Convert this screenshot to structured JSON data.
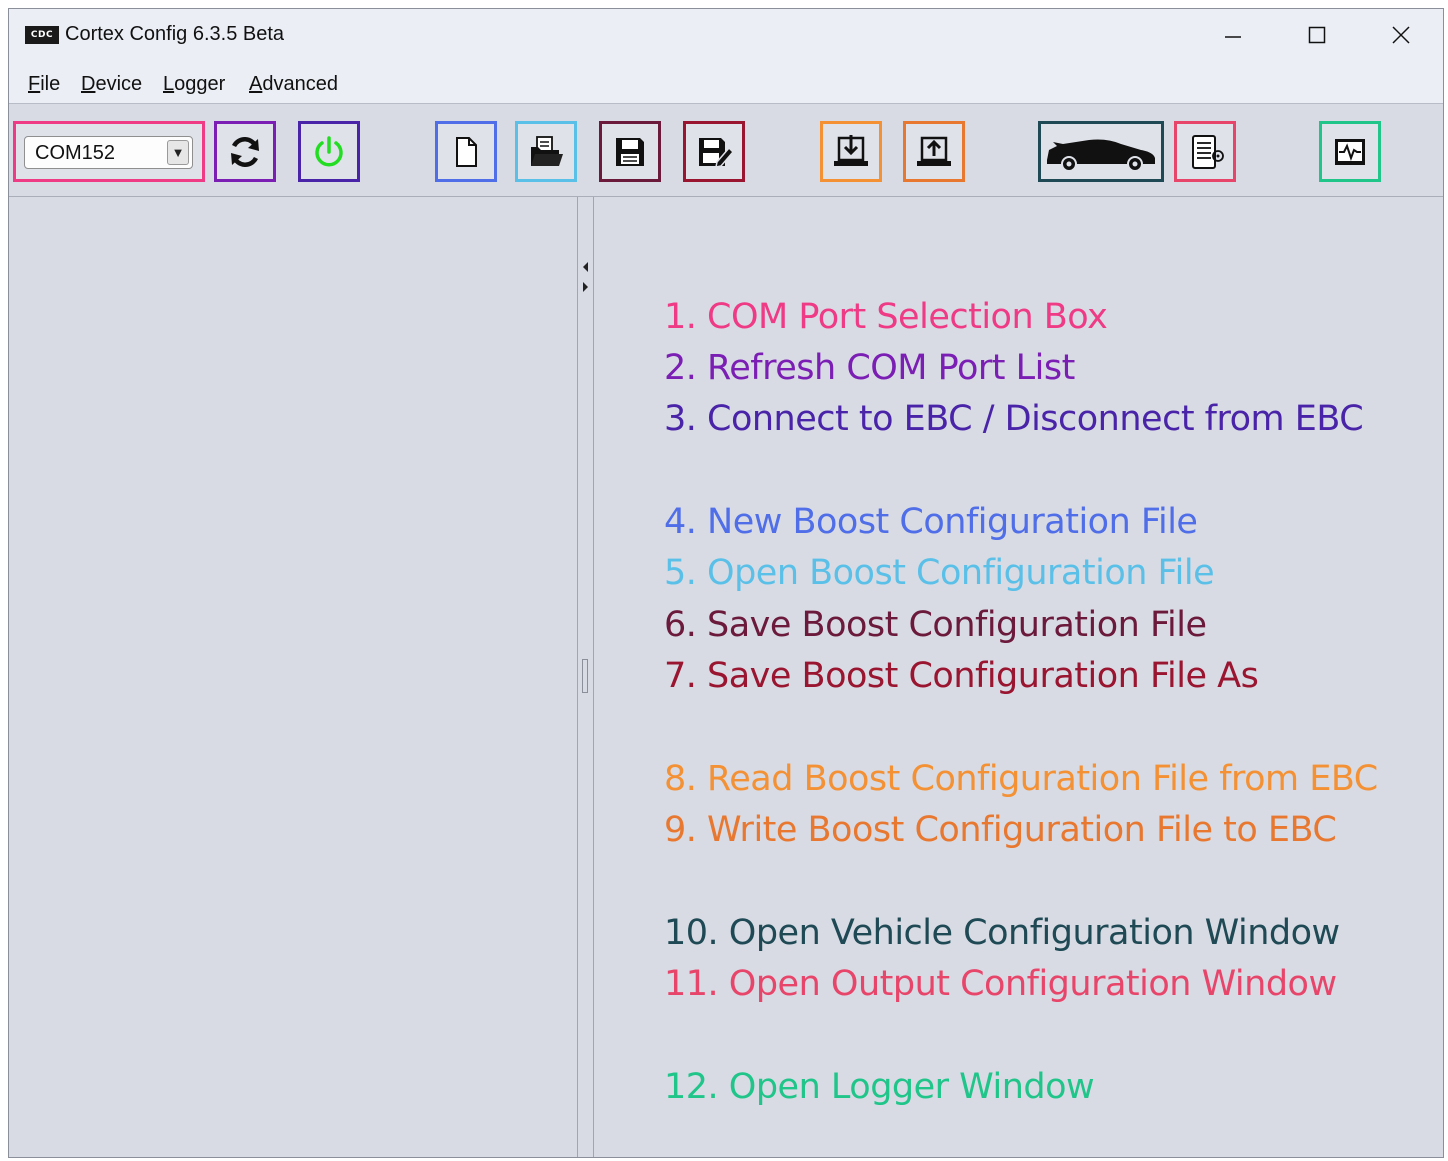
{
  "window": {
    "title": "Cortex Config 6.3.5 Beta",
    "app_icon_text": "CDC",
    "controls": {
      "minimize": "—",
      "maximize": "☐",
      "close": "✕"
    }
  },
  "menu": {
    "file": {
      "mnemonic": "F",
      "rest": "ile"
    },
    "device": {
      "mnemonic": "D",
      "rest": "evice"
    },
    "logger": {
      "mnemonic": "L",
      "rest": "ogger"
    },
    "advanced": {
      "mnemonic": "A",
      "rest": "dvanced"
    }
  },
  "toolbar": {
    "com_port": {
      "value": "COM152",
      "dropdown_arrow": "▼"
    },
    "buttons": [
      {
        "id": 2,
        "icon": "refresh-icon",
        "color": "#7b1fb4"
      },
      {
        "id": 3,
        "icon": "power-icon",
        "color": "#4a24a8"
      },
      {
        "id": 4,
        "icon": "new-file-icon",
        "color": "#4f6ee8"
      },
      {
        "id": 5,
        "icon": "open-folder-icon",
        "color": "#5bc0e8"
      },
      {
        "id": 6,
        "icon": "save-icon",
        "color": "#6b1a3c"
      },
      {
        "id": 7,
        "icon": "save-as-icon",
        "color": "#9a1530"
      },
      {
        "id": 8,
        "icon": "read-from-device-icon",
        "color": "#f39134"
      },
      {
        "id": 9,
        "icon": "write-to-device-icon",
        "color": "#e87830"
      },
      {
        "id": 10,
        "icon": "vehicle-icon",
        "color": "#1f4a55"
      },
      {
        "id": 11,
        "icon": "output-config-icon",
        "color": "#e8456a"
      },
      {
        "id": 12,
        "icon": "logger-icon",
        "color": "#20c58a"
      }
    ]
  },
  "numbers": [
    "1",
    "2",
    "3",
    "4",
    "5",
    "6",
    "7",
    "8",
    "9",
    "10",
    "11",
    "12"
  ],
  "legend": {
    "item1": "1. COM Port Selection Box",
    "item2": "2. Refresh COM Port List",
    "item3": "3. Connect to EBC / Disconnect from EBC",
    "item4": "4. New Boost Configuration File",
    "item5": "5. Open Boost Configuration File",
    "item6": "6. Save Boost Configuration File",
    "item7": "7. Save Boost Configuration File As",
    "item8": "8. Read Boost Configuration File from EBC",
    "item9": "9. Write Boost Configuration File to EBC",
    "item10": "10. Open Vehicle Configuration Window",
    "item11": "11. Open Output Configuration Window",
    "item12": "12. Open Logger Window"
  },
  "colors": {
    "c1": "#ef3a86",
    "c2": "#7b1fb4",
    "c3": "#4a24a8",
    "c4": "#4f6ee8",
    "c5": "#5bc0e8",
    "c6": "#6b1a3c",
    "c7": "#9a1530",
    "c8": "#f39134",
    "c9": "#e87830",
    "c10": "#1f4a55",
    "c11": "#e8456a",
    "c12": "#20c58a",
    "power_green": "#22dd22"
  }
}
